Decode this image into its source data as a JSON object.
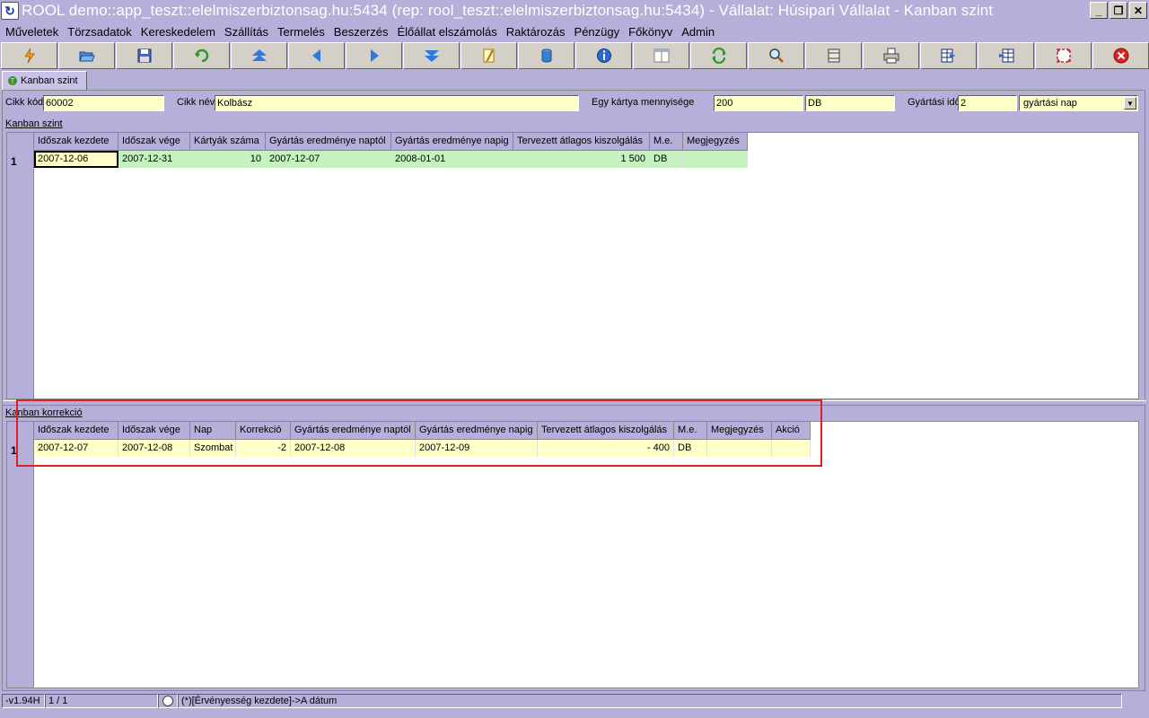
{
  "window": {
    "title": "ROOL demo::app_teszt::elelmiszerbiztonsag.hu:5434 (rep: rool_teszt::elelmiszerbiztonsag.hu:5434) - Vállalat: Húsipari Vállalat - Kanban szint",
    "minimize": "_",
    "restore": "❐",
    "close": "✕"
  },
  "menu": [
    "Műveletek",
    "Törzsadatok",
    "Kereskedelem",
    "Szállítás",
    "Termelés",
    "Beszerzés",
    "Élőállat elszámolás",
    "Raktározás",
    "Pénzügy",
    "Főkönyv",
    "Admin"
  ],
  "toolbar": {
    "icons": [
      "flash-icon",
      "open-folder-icon",
      "save-icon",
      "refresh-green-icon",
      "first-record-icon",
      "previous-record-icon",
      "next-record-icon",
      "last-record-icon",
      "edit-icon",
      "database-icon",
      "info-icon",
      "window-layout-icon",
      "reload-icon",
      "search-icon",
      "grid-lines-icon",
      "print-icon",
      "table-export-icon",
      "table-import-icon",
      "maximize-icon",
      "close-red-icon"
    ]
  },
  "tab": {
    "label": "Kanban szint"
  },
  "form": {
    "cikk_kod_label": "Cikk kód",
    "cikk_kod_value": "60002",
    "cikk_nev_label": "Cikk név",
    "cikk_nev_value": "Kolbász",
    "kartya_label": "Egy kártya mennyisége",
    "kartya_value": "200",
    "kartya_unit": "DB",
    "gyartasi_ido_label": "Gyártási idő",
    "gyartasi_ido_value": "2",
    "gyartasi_ido_unit": "gyártási nap"
  },
  "kanban_szint": {
    "label": "Kanban szint",
    "columns": [
      "Időszak kezdete",
      "Időszak vége",
      "Kártyák száma",
      "Gyártás eredménye naptól",
      "Gyártás eredménye napig",
      "Tervezett átlagos kiszolgálás",
      "M.e.",
      "Megjegyzés"
    ],
    "rows": [
      {
        "num": "1",
        "cells": [
          "2007-12-06",
          "2007-12-31",
          "10",
          "2007-12-07",
          "2008-01-01",
          "1 500",
          "DB",
          ""
        ]
      }
    ]
  },
  "kanban_korrekcio": {
    "label": "Kanban korrekció",
    "columns": [
      "Időszak kezdete",
      "Időszak vége",
      "Nap",
      "Korrekció",
      "Gyártás eredménye naptól",
      "Gyártás eredménye napig",
      "Tervezett átlagos kiszolgálás",
      "M.e.",
      "Megjegyzés",
      "Akció"
    ],
    "rows": [
      {
        "num": "1",
        "cells": [
          "2007-12-07",
          "2007-12-08",
          "Szombat",
          "-2",
          "2007-12-08",
          "2007-12-09",
          "- 400",
          "DB",
          "",
          ""
        ]
      }
    ]
  },
  "status": {
    "version": "-v1.94H",
    "record": "1 / 1",
    "message": "(*)[Érvényesség kezdete]->A dátum"
  },
  "colors": {
    "chrome": "#b5afd9",
    "row_green": "#c6f2c0",
    "row_yellow": "#ffffc8",
    "highlight": "#e02020"
  }
}
